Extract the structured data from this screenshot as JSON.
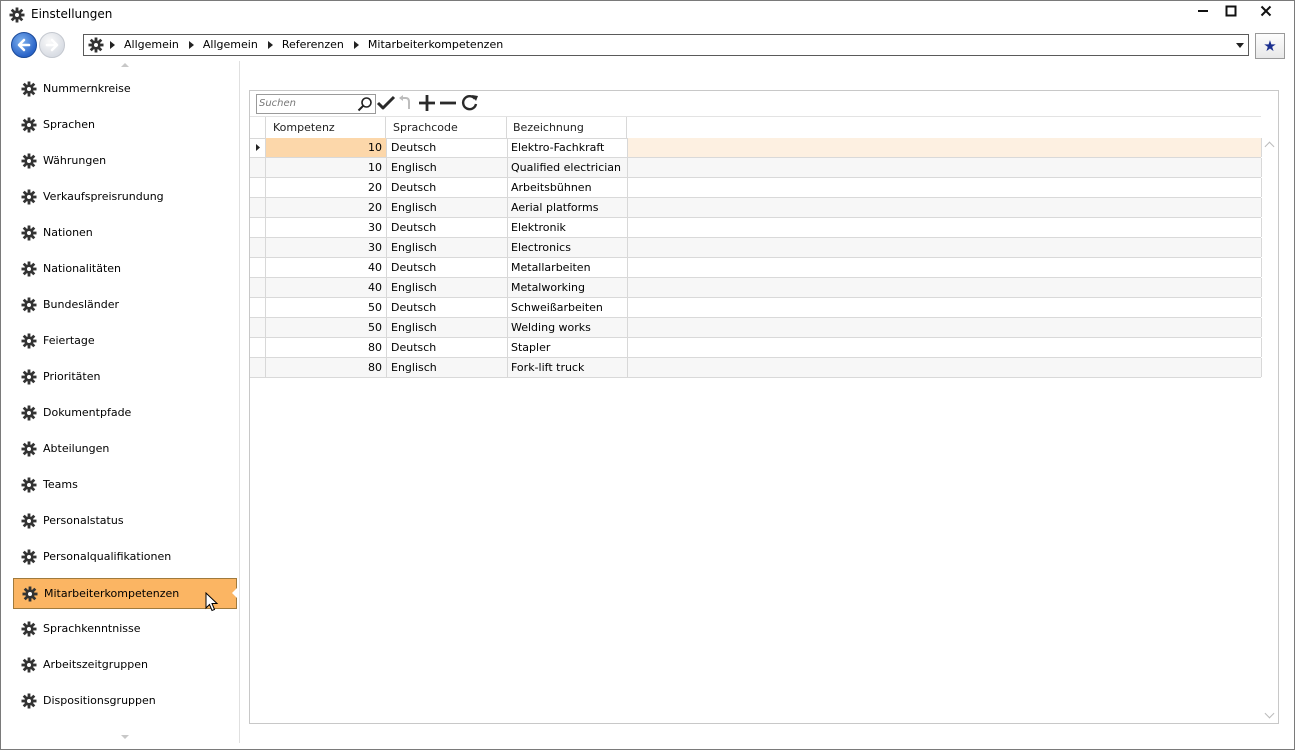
{
  "window": {
    "title": "Einstellungen",
    "minimize": "—",
    "maximize": "□",
    "close": "✕"
  },
  "nav": {
    "breadcrumbs": [
      "Allgemein",
      "Allgemein",
      "Referenzen",
      "Mitarbeiterkompetenzen"
    ],
    "favorite_icon": "★"
  },
  "sidebar": {
    "items": [
      {
        "label": "Nummernkreise"
      },
      {
        "label": "Sprachen"
      },
      {
        "label": "Währungen"
      },
      {
        "label": "Verkaufspreisrundung"
      },
      {
        "label": "Nationen"
      },
      {
        "label": "Nationalitäten"
      },
      {
        "label": "Bundesländer"
      },
      {
        "label": "Feiertage"
      },
      {
        "label": "Prioritäten"
      },
      {
        "label": "Dokumentpfade"
      },
      {
        "label": "Abteilungen"
      },
      {
        "label": "Teams"
      },
      {
        "label": "Personalstatus"
      },
      {
        "label": "Personalqualifikationen"
      },
      {
        "label": "Mitarbeiterkompetenzen",
        "selected": true
      },
      {
        "label": "Sprachkenntnisse"
      },
      {
        "label": "Arbeitszeitgruppen"
      },
      {
        "label": "Dispositionsgruppen"
      }
    ]
  },
  "toolbar": {
    "search_placeholder": "Suchen"
  },
  "grid": {
    "columns": [
      "Kompetenz",
      "Sprachcode",
      "Bezeichnung"
    ],
    "rows": [
      {
        "kompetenz": "10",
        "sprachcode": "Deutsch",
        "bezeichnung": "Elektro-Fachkraft",
        "selected": true
      },
      {
        "kompetenz": "10",
        "sprachcode": "Englisch",
        "bezeichnung": "Qualified electrician"
      },
      {
        "kompetenz": "20",
        "sprachcode": "Deutsch",
        "bezeichnung": "Arbeitsbühnen"
      },
      {
        "kompetenz": "20",
        "sprachcode": "Englisch",
        "bezeichnung": "Aerial platforms"
      },
      {
        "kompetenz": "30",
        "sprachcode": "Deutsch",
        "bezeichnung": "Elektronik"
      },
      {
        "kompetenz": "30",
        "sprachcode": "Englisch",
        "bezeichnung": "Electronics"
      },
      {
        "kompetenz": "40",
        "sprachcode": "Deutsch",
        "bezeichnung": "Metallarbeiten"
      },
      {
        "kompetenz": "40",
        "sprachcode": "Englisch",
        "bezeichnung": "Metalworking"
      },
      {
        "kompetenz": "50",
        "sprachcode": "Deutsch",
        "bezeichnung": "Schweißarbeiten"
      },
      {
        "kompetenz": "50",
        "sprachcode": "Englisch",
        "bezeichnung": "Welding works"
      },
      {
        "kompetenz": "80",
        "sprachcode": "Deutsch",
        "bezeichnung": "Stapler"
      },
      {
        "kompetenz": "80",
        "sprachcode": "Englisch",
        "bezeichnung": "Fork-lift truck"
      }
    ]
  },
  "colors": {
    "accent": "#fbb563",
    "selected_row": "#fdf0e1",
    "back_button": "#2a64c8"
  }
}
